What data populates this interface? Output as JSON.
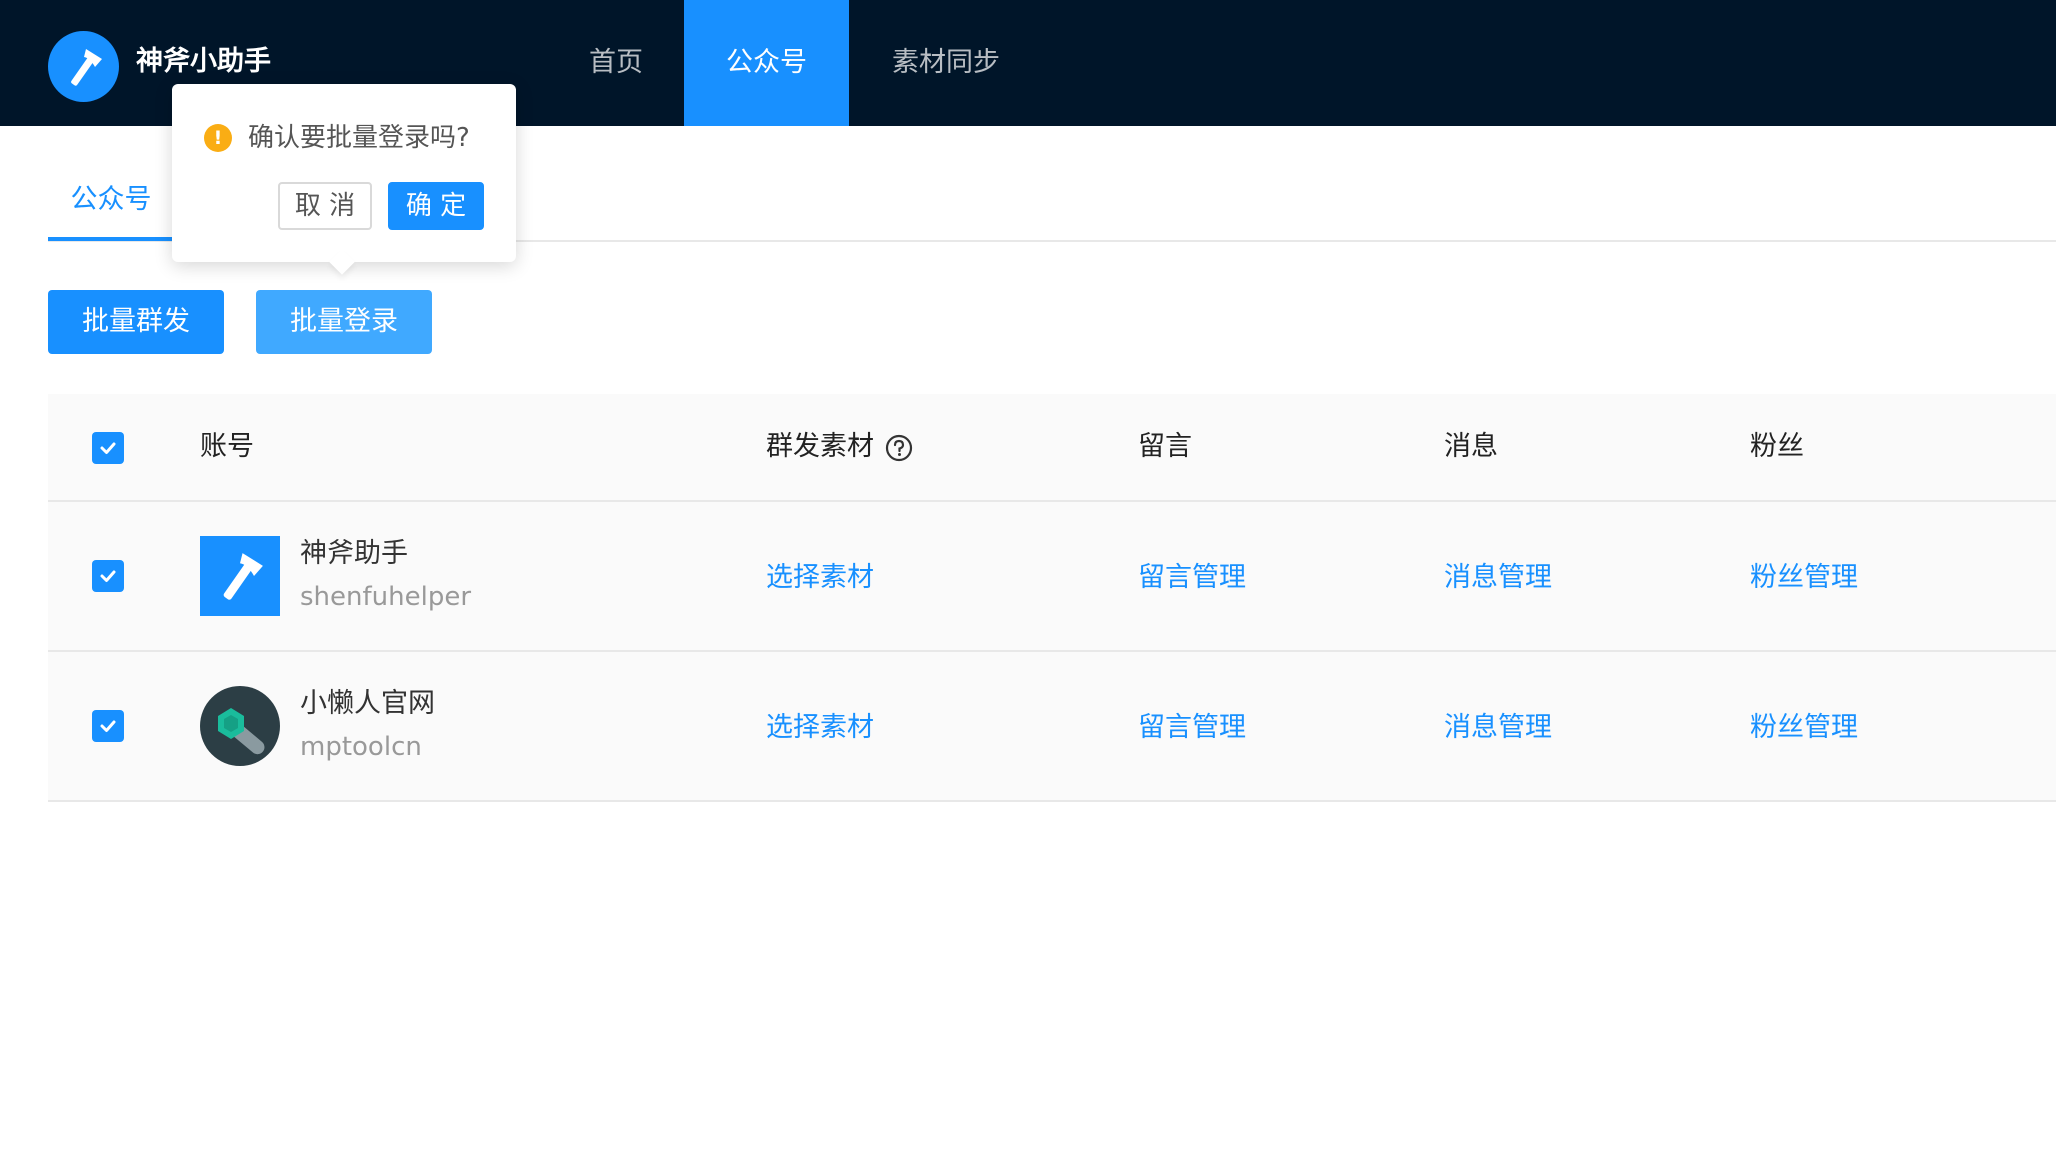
{
  "header": {
    "app_title": "神斧小助手",
    "logo_icon": "axe-icon",
    "nav": [
      {
        "label": "首页",
        "active": false
      },
      {
        "label": "公众号",
        "active": true
      },
      {
        "label": "素材同步",
        "active": false
      }
    ]
  },
  "tabs": [
    {
      "label": "公众号",
      "active": true
    }
  ],
  "actions": {
    "batch_send": "批量群发",
    "batch_login": "批量登录"
  },
  "popconfirm": {
    "icon": "exclamation-icon",
    "message": "确认要批量登录吗?",
    "cancel_label": "取 消",
    "ok_label": "确 定"
  },
  "table": {
    "select_all_checked": true,
    "columns": [
      "账号",
      "群发素材",
      "留言",
      "消息",
      "粉丝"
    ],
    "rows": [
      {
        "checked": true,
        "avatar_icon": "axe-icon",
        "name": "神斧助手",
        "account_id": "shenfuhelper",
        "material_link": "选择素材",
        "comment_link": "留言管理",
        "message_link": "消息管理",
        "fans_link": "粉丝管理"
      },
      {
        "checked": true,
        "avatar_icon": "hex-wrench-icon",
        "name": "小懒人官网",
        "account_id": "mptoolcn",
        "material_link": "选择素材",
        "comment_link": "留言管理",
        "message_link": "消息管理",
        "fans_link": "粉丝管理"
      }
    ]
  },
  "colors": {
    "header_bg": "#001529",
    "primary": "#1890ff",
    "primary_light": "#40a9ff",
    "warning": "#faad14"
  }
}
